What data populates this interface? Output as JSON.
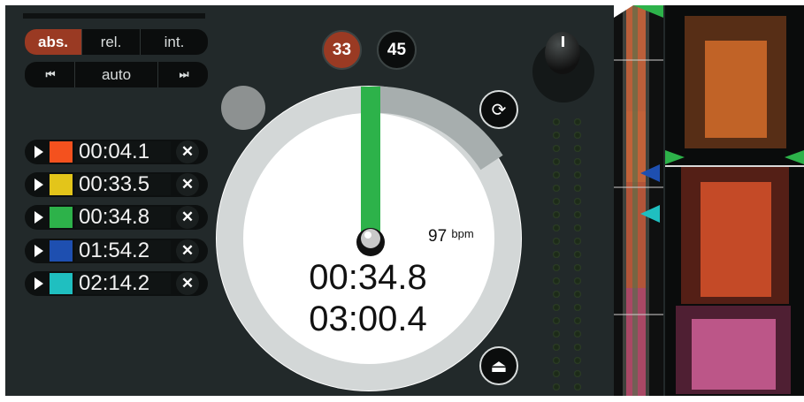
{
  "mode_selector": {
    "options": [
      "abs.",
      "rel.",
      "int."
    ],
    "selected": "abs."
  },
  "sync_controls": {
    "prev_label": "⏮",
    "mode_label": "auto",
    "next_label": "⏭"
  },
  "cue_points": [
    {
      "time": "00:04.1",
      "color": "#f4511e"
    },
    {
      "time": "00:33.5",
      "color": "#e3c51a"
    },
    {
      "time": "00:34.8",
      "color": "#2db24a"
    },
    {
      "time": "01:54.2",
      "color": "#1e4fb0"
    },
    {
      "time": "02:14.2",
      "color": "#1fbfc0"
    }
  ],
  "speed_buttons": {
    "slow": "33",
    "fast": "45",
    "selected": "33"
  },
  "platter": {
    "bpm_value": "97",
    "bpm_unit": "bpm",
    "elapsed": "00:34.8",
    "total": "03:00.4"
  },
  "colors": {
    "background": "#22292a",
    "accent_active": "#9a3a23",
    "playhead": "#2db24a",
    "cue_blue": "#1e4fb0",
    "cue_cyan": "#1fbfc0"
  },
  "icons": {
    "loop": "loop-icon",
    "eject": "eject-icon",
    "play": "play-icon",
    "delete": "close-icon"
  }
}
